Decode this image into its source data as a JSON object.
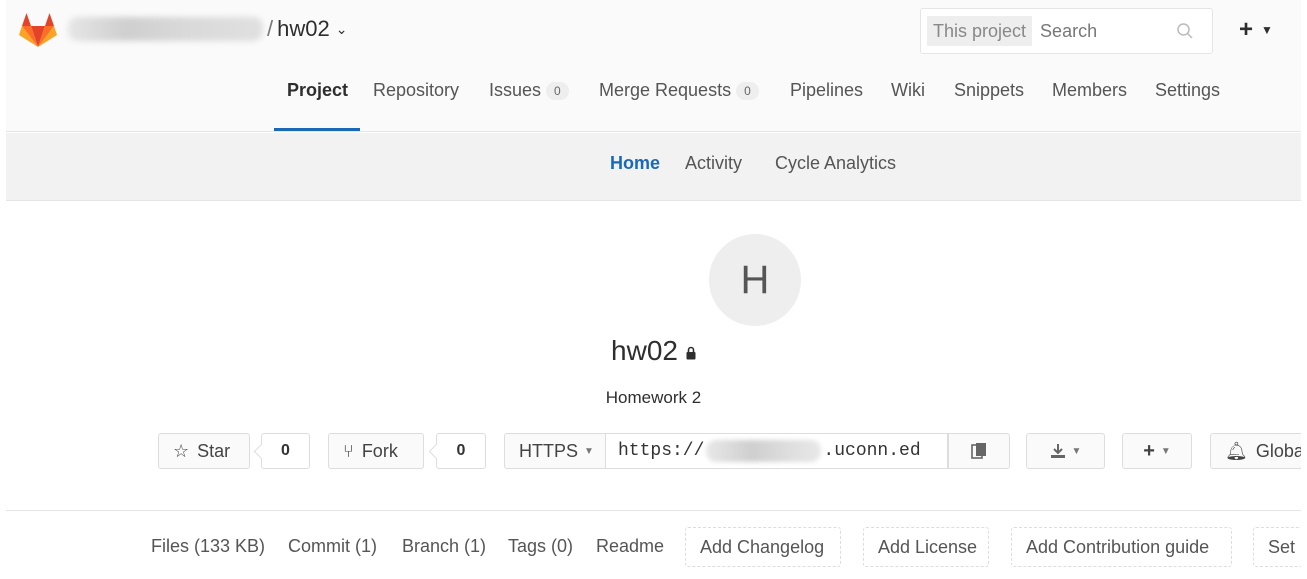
{
  "header": {
    "project_name": "hw02",
    "breadcrumb_separator": "/",
    "search_scope": "This project",
    "search_placeholder": "Search",
    "add_button": "+"
  },
  "nav": {
    "items": [
      {
        "label": "Project",
        "active": true
      },
      {
        "label": "Repository"
      },
      {
        "label": "Issues",
        "badge": "0"
      },
      {
        "label": "Merge Requests",
        "badge": "0"
      },
      {
        "label": "Pipelines"
      },
      {
        "label": "Wiki"
      },
      {
        "label": "Snippets"
      },
      {
        "label": "Members"
      },
      {
        "label": "Settings"
      }
    ]
  },
  "subnav": {
    "items": [
      {
        "label": "Home",
        "active": true
      },
      {
        "label": "Activity"
      },
      {
        "label": "Cycle Analytics"
      }
    ]
  },
  "project": {
    "avatar_letter": "H",
    "title": "hw02",
    "description": "Homework 2"
  },
  "actions": {
    "star_label": "Star",
    "star_count": "0",
    "fork_label": "Fork",
    "fork_count": "0",
    "protocol": "HTTPS",
    "url_prefix": "https://",
    "url_suffix": ".uconn.ed",
    "notification_label": "Globa"
  },
  "stats": {
    "files": "Files (133 KB)",
    "commit": "Commit (1)",
    "branch": "Branch (1)",
    "tags": "Tags (0)",
    "readme": "Readme",
    "add_changelog": "Add Changelog",
    "add_license": "Add License",
    "add_contribution": "Add Contribution guide",
    "setup": "Set u"
  },
  "colors": {
    "accent": "#1b69b6",
    "logo_orange": "#fc6d26",
    "logo_red": "#e24329"
  }
}
